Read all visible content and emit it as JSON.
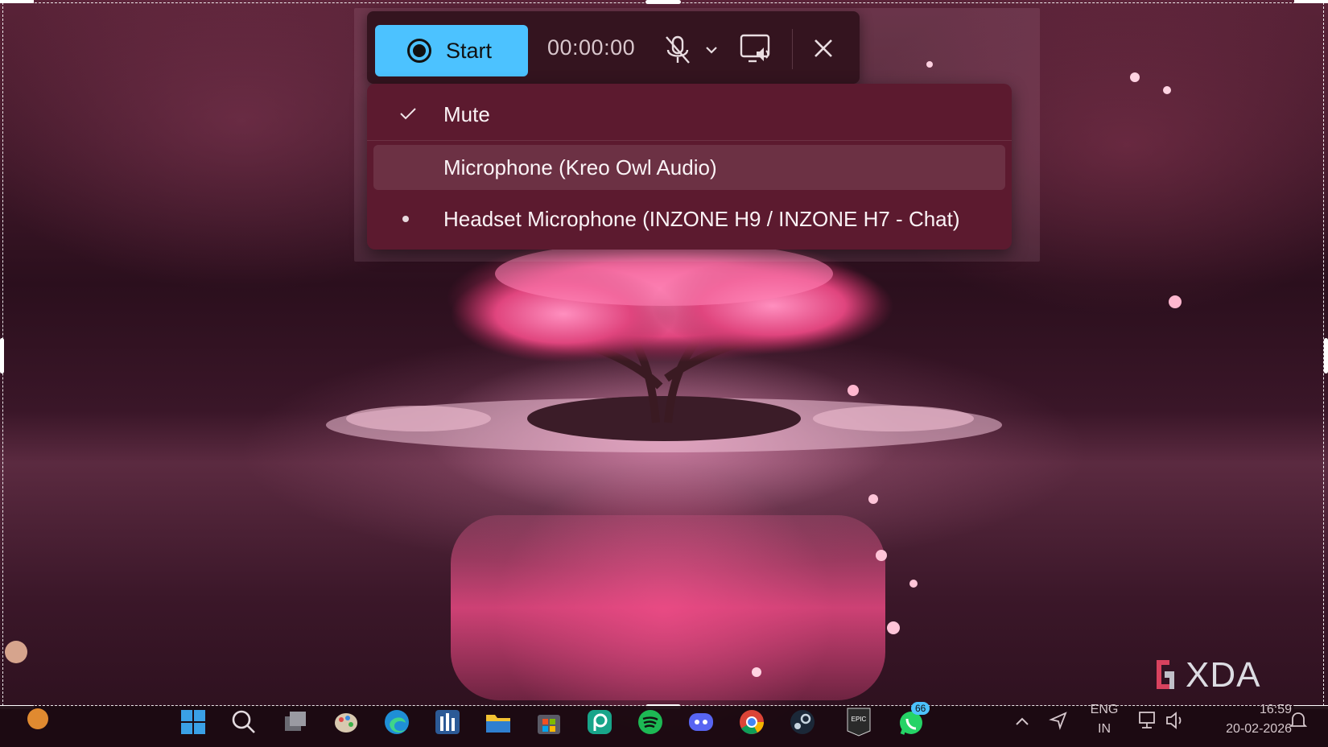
{
  "recording_toolbar": {
    "start_label": "Start",
    "timer": "00:00:00",
    "mic_state": "muted",
    "accent_color": "#4cc2ff"
  },
  "mic_menu": {
    "items": [
      {
        "label": "Mute",
        "checked": true
      },
      {
        "label": "Microphone (Kreo Owl Audio)",
        "hovered": true
      },
      {
        "label": "Headset Microphone (INZONE H9 / INZONE H7 - Chat)",
        "selected": true
      }
    ]
  },
  "watermark": {
    "text": "XDA"
  },
  "taskbar": {
    "apps": [
      {
        "name": "start-icon"
      },
      {
        "name": "search-icon"
      },
      {
        "name": "task-view-icon"
      },
      {
        "name": "paint-icon"
      },
      {
        "name": "edge-icon"
      },
      {
        "name": "app-icon"
      },
      {
        "name": "file-explorer-icon"
      },
      {
        "name": "store-icon"
      },
      {
        "name": "picsart-icon"
      },
      {
        "name": "spotify-icon"
      },
      {
        "name": "discord-icon"
      },
      {
        "name": "chrome-icon"
      },
      {
        "name": "steam-icon"
      },
      {
        "name": "epic-games-icon"
      },
      {
        "name": "whatsapp-icon",
        "badge": "66"
      }
    ],
    "tray": {
      "language": "ENG",
      "region": "IN",
      "time": "16:59",
      "date": "20-02-2026"
    }
  }
}
